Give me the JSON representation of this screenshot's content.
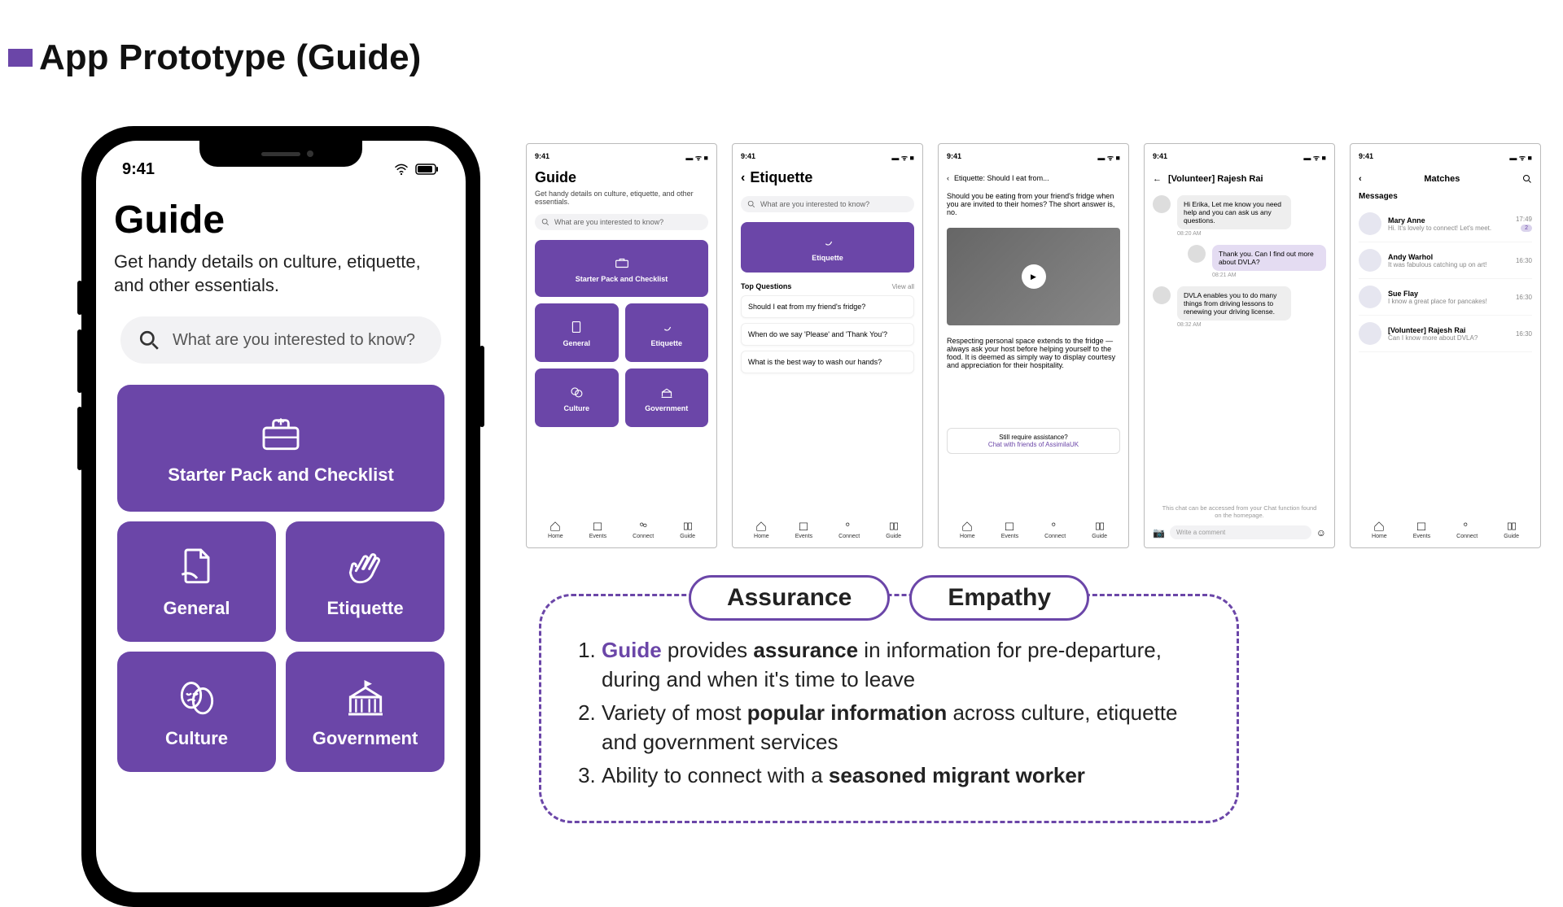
{
  "title": "App Prototype (Guide)",
  "phone": {
    "time": "9:41",
    "h1": "Guide",
    "sub": "Get handy details on culture, etiquette, and other essentials.",
    "search_placeholder": "What are you interested to know?",
    "tiles": {
      "starter": "Starter Pack and Checklist",
      "general": "General",
      "etiquette": "Etiquette",
      "culture": "Culture",
      "government": "Government"
    }
  },
  "thumbs": {
    "time": "9:41",
    "guide": {
      "h1": "Guide",
      "sub": "Get handy details on culture, etiquette, and other essentials.",
      "search": "What are you interested to know?",
      "tiles": [
        "Starter Pack and Checklist",
        "General",
        "Etiquette",
        "Culture",
        "Government"
      ]
    },
    "etiquette": {
      "h1": "Etiquette",
      "search": "What are you interested to know?",
      "tile": "Etiquette",
      "section": "Top Questions",
      "viewall": "View all",
      "questions": [
        "Should I eat from my friend's fridge?",
        "When do we say 'Please' and 'Thank You'?",
        "What is the best way to wash our hands?"
      ]
    },
    "article": {
      "header": "Etiquette: Should I eat from...",
      "lead": "Should you be eating from your friend's fridge when you are invited to their homes? The short answer is, no.",
      "body": "Respecting personal space extends to the fridge — always ask your host before helping yourself to the food. It is deemed as simply way to display courtesy and appreciation for their hospitality.",
      "assist1": "Still require assistance?",
      "assist2": "Chat with friends of AssimilaUK"
    },
    "chat": {
      "title": "[Volunteer] Rajesh Rai",
      "m1": "Hi Erika, Let me know you need help and you can ask us any questions.",
      "t1": "08:20 AM",
      "m2": "Thank you. Can I find out more about DVLA?",
      "t2": "08:21 AM",
      "m3": "DVLA enables you to do many things from driving lessons to renewing your driving license.",
      "t3": "08:32 AM",
      "footnote": "This chat can be accessed from your Chat function found on the homepage.",
      "input": "Write a comment"
    },
    "matches": {
      "title": "Matches",
      "section": "Messages",
      "rows": [
        {
          "name": "Mary Anne",
          "msg": "Hi. It's lovely to connect! Let's meet.",
          "time": "17:49",
          "badge": "2"
        },
        {
          "name": "Andy Warhol",
          "msg": "It was fabulous catching up on art!",
          "time": "16:30"
        },
        {
          "name": "Sue Flay",
          "msg": "I know a great place for pancakes!",
          "time": "16:30"
        },
        {
          "name": "[Volunteer] Rajesh Rai",
          "msg": "Can I know more about DVLA?",
          "time": "16:30"
        }
      ]
    },
    "nav": [
      "Home",
      "Events",
      "Connect",
      "Guide"
    ]
  },
  "callout": {
    "badges": [
      "Assurance",
      "Empathy"
    ],
    "b1_hl": "Guide",
    "b1_a": " provides ",
    "b1_b": "assurance",
    "b1_c": " in information for pre-departure, during and when it's time to leave",
    "b2_a": "Variety of most ",
    "b2_b": "popular information",
    "b2_c": " across culture, etiquette and government services",
    "b3_a": "Ability to connect with a ",
    "b3_b": "seasoned migrant worker"
  }
}
